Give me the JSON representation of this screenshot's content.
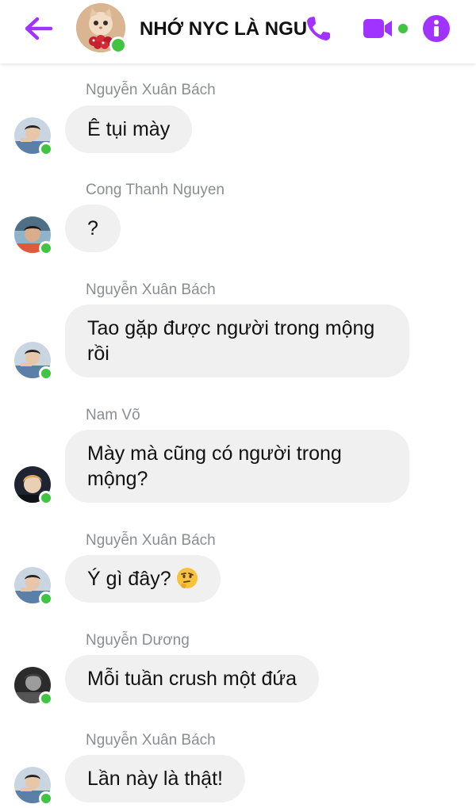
{
  "colors": {
    "accent": "#a033ff",
    "online": "#42c443",
    "bubble": "#f0f0f0",
    "sender_text": "#8a8d91"
  },
  "header": {
    "back_icon": "arrow-left-icon",
    "title": "NHỚ NYC LÀ NGU",
    "call_icon": "phone-icon",
    "video_icon": "video-camera-icon",
    "info_icon": "info-icon"
  },
  "messages": [
    {
      "sender": "Nguyễn Xuân Bách",
      "text": "Ê tụi mày"
    },
    {
      "sender": "Cong Thanh Nguyen",
      "text": "?"
    },
    {
      "sender": "Nguyễn Xuân Bách",
      "text": "Tao gặp được người trong mộng rồi"
    },
    {
      "sender": "Nam Võ",
      "text": "Mày mà cũng có người trong mộng?"
    },
    {
      "sender": "Nguyễn Xuân Bách",
      "text": "Ý gì đây?",
      "emoji": "thinking-face-icon"
    },
    {
      "sender": "Nguyễn Dương",
      "text": "Mỗi tuần crush một đứa"
    },
    {
      "sender": "Nguyễn Xuân Bách",
      "text": "Lần này là thật!"
    }
  ]
}
